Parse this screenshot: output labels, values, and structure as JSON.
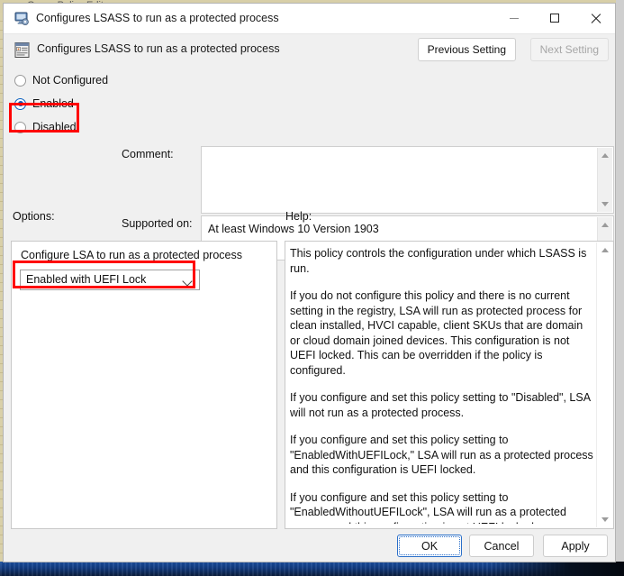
{
  "background": {
    "underlying_window_title": "Group Policy Editor"
  },
  "window": {
    "title": "Configures LSASS to run as a protected process",
    "icon": "policy-window-icon",
    "controls": {
      "minimize": "minimize-icon",
      "maximize": "maximize-icon",
      "close": "close-icon"
    }
  },
  "header": {
    "policy_title": "Configures LSASS to run as a protected process",
    "icon": "policy-setting-icon",
    "previous_setting_label": "Previous Setting",
    "next_setting_label": "Next Setting",
    "next_setting_enabled": false
  },
  "state": {
    "options": [
      {
        "label": "Not Configured",
        "selected": false
      },
      {
        "label": "Enabled",
        "selected": true
      },
      {
        "label": "Disabled",
        "selected": false
      }
    ]
  },
  "comment": {
    "label": "Comment:",
    "value": "",
    "placeholder": ""
  },
  "supported_on": {
    "label": "Supported on:",
    "value": "At least Windows 10 Version 1903"
  },
  "options_section": {
    "label": "Options:",
    "setting_label": "Configure LSA to run as a protected process",
    "dropdown_value": "Enabled with UEFI Lock",
    "dropdown_icon": "chevron-down-icon"
  },
  "help_section": {
    "label": "Help:",
    "paragraphs": [
      "This policy controls the configuration under which LSASS is run.",
      "If you do not configure this policy and there is no current setting in the registry, LSA will run as protected process for clean installed, HVCI capable, client SKUs that are domain or cloud domain joined devices. This configuration is not UEFI locked. This can be overridden if the policy is configured.",
      "If you configure and set this policy setting to \"Disabled\", LSA will not run as a protected process.",
      "If you configure and set this policy setting to \"EnabledWithUEFILock,\" LSA will run as a protected process and this configuration is UEFI locked.",
      "If you configure and set this policy setting to \"EnabledWithoutUEFILock\", LSA will run as a protected process and this configuration is not UEFI locked."
    ]
  },
  "footer": {
    "ok_label": "OK",
    "cancel_label": "Cancel",
    "apply_label": "Apply"
  },
  "annotations": {
    "color": "#ff0000",
    "highlights": [
      "Enabled",
      "Enabled with UEFI Lock"
    ]
  }
}
